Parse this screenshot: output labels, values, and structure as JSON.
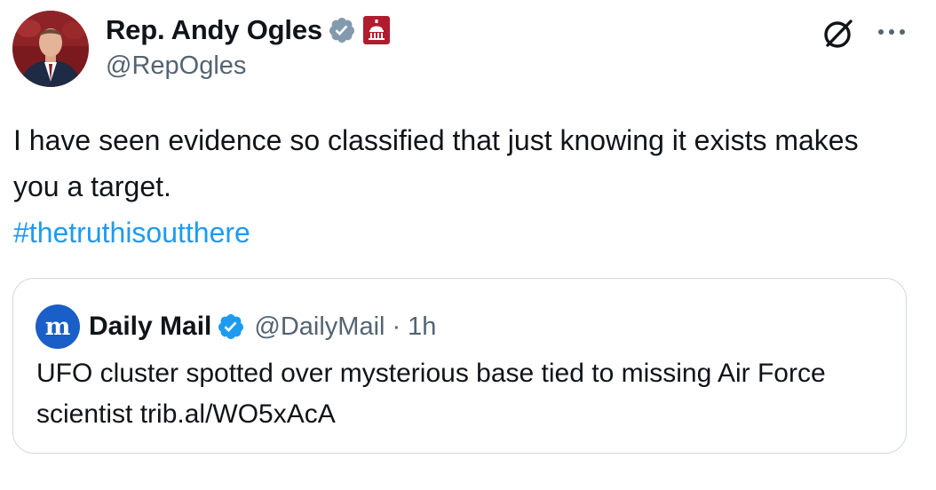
{
  "tweet": {
    "author": {
      "display_name": "Rep. Andy Ogles",
      "handle": "@RepOgles",
      "verified_color": "#829aab",
      "affiliation_badge_color": "#b01c2e"
    },
    "text": "I have seen evidence so classified that just knowing it exists makes you a target.",
    "hashtag": "#thetruthisoutthere",
    "icons": {
      "grok": "grok-icon",
      "more": "more-icon"
    }
  },
  "quote": {
    "author": {
      "display_name": "Daily Mail",
      "handle": "@DailyMail",
      "separator": "·",
      "time": "1h",
      "verified_color": "#1d9bf0",
      "logo_color": "#1a5ec7"
    },
    "text": "UFO cluster spotted over mysterious base tied to missing Air Force scientist trib.al/WO5xAcA"
  },
  "colors": {
    "text_primary": "#0f1419",
    "text_secondary": "#536471",
    "link": "#1d9bf0",
    "border": "#cfd9de"
  }
}
